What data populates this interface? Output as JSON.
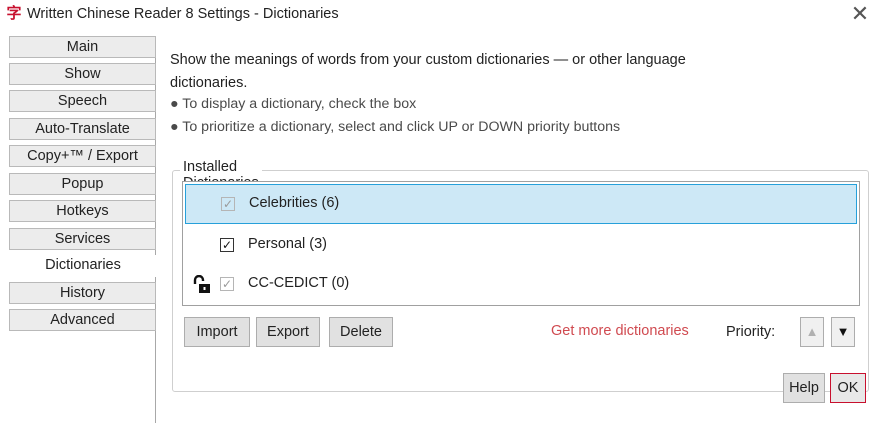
{
  "window": {
    "icon_glyph": "字",
    "title": "Written Chinese Reader 8 Settings - Dictionaries",
    "close_glyph": "✕"
  },
  "sidebar": {
    "items": [
      {
        "label": "Main",
        "active": false
      },
      {
        "label": "Show",
        "active": false
      },
      {
        "label": "Speech",
        "active": false
      },
      {
        "label": "Auto-Translate",
        "active": false
      },
      {
        "label": "Copy+™ / Export",
        "active": false
      },
      {
        "label": "Popup",
        "active": false
      },
      {
        "label": "Hotkeys",
        "active": false
      },
      {
        "label": "Services",
        "active": false
      },
      {
        "label": "Dictionaries",
        "active": true
      },
      {
        "label": "History",
        "active": false
      },
      {
        "label": "Advanced",
        "active": false
      }
    ]
  },
  "main": {
    "description_line1": "Show the meanings of words from your custom dictionaries — or other language",
    "description_line2": "dictionaries.",
    "bullet1": "● To display a dictionary, check the box",
    "bullet2": "● To prioritize a dictionary, select and click UP or DOWN priority buttons",
    "group_label": "Installed Dictionaries",
    "dictionaries": [
      {
        "label": "Celebrities (6)",
        "checked": true,
        "enabled": false,
        "selected": true,
        "locked": false
      },
      {
        "label": "Personal (3)",
        "checked": true,
        "enabled": true,
        "selected": false,
        "locked": false
      },
      {
        "label": "CC-CEDICT (0)",
        "checked": true,
        "enabled": false,
        "selected": false,
        "locked": true
      }
    ],
    "check_glyph": "✓",
    "buttons": {
      "import": "Import",
      "export": "Export",
      "delete": "Delete",
      "get_more": "Get more dictionaries",
      "priority_label": "Priority:",
      "up_glyph": "▲",
      "down_glyph": "▼"
    },
    "footer": {
      "help": "Help",
      "ok": "OK"
    }
  },
  "colors": {
    "accent_red": "#c8102e",
    "link_red": "#d04a50",
    "selection_bg": "#cde8f6",
    "selection_border": "#26a0da"
  }
}
